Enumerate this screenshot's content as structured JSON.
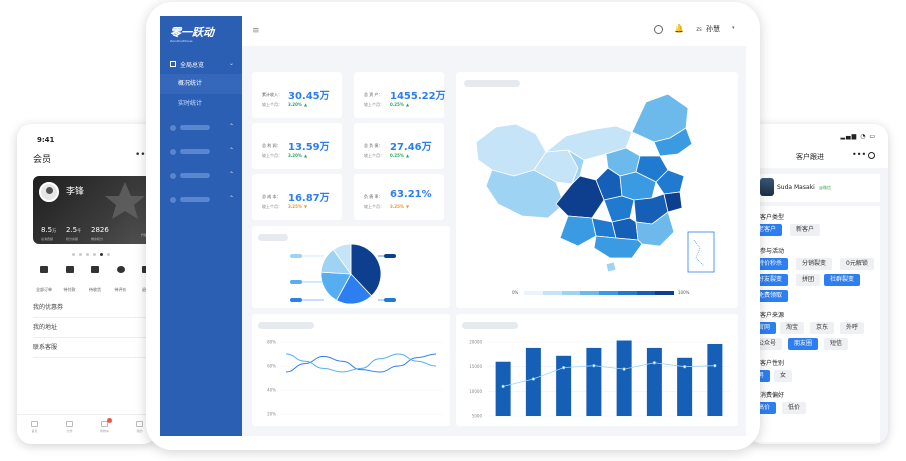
{
  "dashboard": {
    "logo": "零一跃动",
    "logo_sub": "ZeroOneMoves",
    "topbar_user_initial": "ZS",
    "topbar_user": "孙慧",
    "menu": {
      "group": "全局总览",
      "items": [
        {
          "label": "概况统计",
          "active": true
        },
        {
          "label": "实时统计",
          "active": false
        }
      ]
    },
    "kpis": [
      {
        "label": "累计收入：",
        "value": "30.45万",
        "compare_label": "较上个月：",
        "change": "3.20%",
        "trend": "up",
        "color": "#2aa45f"
      },
      {
        "label": "总 资 产：",
        "value": "1455.22万",
        "compare_label": "较上个月：",
        "change": "0.25%",
        "trend": "up",
        "color": "#2aa45f"
      },
      {
        "label": "总 利 润：",
        "value": "13.59万",
        "compare_label": "较上个月：",
        "change": "3.20%",
        "trend": "up",
        "color": "#2aa45f"
      },
      {
        "label": "总 负 债：",
        "value": "27.46万",
        "compare_label": "较上个月：",
        "change": "0.25%",
        "trend": "up",
        "color": "#2aa45f"
      },
      {
        "label": "总 成 本：",
        "value": "16.87万",
        "compare_label": "较上个月：",
        "change": "3.25%",
        "trend": "down",
        "color": "#f0932b"
      },
      {
        "label": "负 债 率：",
        "value": "63.21%",
        "compare_label": "较上个月：",
        "change": "3.25%",
        "trend": "down",
        "color": "#f0932b"
      }
    ],
    "map_legend": {
      "min": "0%",
      "max": "100%",
      "colors": [
        "#eaf4fc",
        "#c6e4f8",
        "#9fd3f3",
        "#6cb9ec",
        "#3a9be2",
        "#1f7ad0",
        "#155fb6",
        "#0d3f8e"
      ]
    },
    "pie": {
      "colors": [
        "#0d3f8e",
        "#2d7ef0",
        "#56aef0",
        "#9fd3f3",
        "#c6e4f8"
      ]
    },
    "bottom_cards": {
      "left": "",
      "right": ""
    }
  },
  "chart_data": [
    {
      "type": "pie",
      "title": "",
      "values": [
        38,
        20,
        18,
        14,
        10
      ]
    },
    {
      "type": "line",
      "title": "",
      "xlabel": "",
      "ylabel": "",
      "y_ticks": [
        "80%",
        "60%",
        "40%",
        "20%"
      ],
      "ylim": [
        20,
        80
      ],
      "x": [
        0,
        1,
        2,
        3,
        4,
        5,
        6,
        7,
        8
      ],
      "series": [
        {
          "values": [
            55,
            62,
            68,
            64,
            57,
            55,
            60,
            67,
            70
          ]
        },
        {
          "values": [
            70,
            64,
            58,
            55,
            58,
            66,
            70,
            64,
            60
          ]
        }
      ]
    },
    {
      "type": "bar",
      "title": "",
      "xlabel": "",
      "ylabel": "",
      "y_ticks": [
        "20000",
        "15000",
        "10000",
        "5000"
      ],
      "ylim": [
        5000,
        20000
      ],
      "categories": [
        "",
        "",
        "",
        "",
        "",
        "",
        "",
        ""
      ],
      "series": [
        {
          "type": "bar",
          "values": [
            16000,
            18800,
            17200,
            18800,
            20300,
            18800,
            16800,
            19600
          ]
        },
        {
          "type": "line",
          "values": [
            11000,
            12500,
            14800,
            15200,
            14500,
            15800,
            15000,
            15200
          ]
        }
      ]
    }
  ],
  "phone_left": {
    "time": "9:41",
    "title": "会员",
    "user_name": "李锋",
    "stats": [
      {
        "value": "8.5",
        "unit": "万",
        "label": "总消费额"
      },
      {
        "value": "2.5",
        "unit": "千",
        "label": "积分余额"
      },
      {
        "value": "2826",
        "unit": "",
        "label": "剩余积分"
      }
    ],
    "extra": "升级攻略",
    "icons": [
      {
        "label": "全部订单"
      },
      {
        "label": "待付款"
      },
      {
        "label": "待收货"
      },
      {
        "label": "待评价"
      },
      {
        "label": "退款"
      }
    ],
    "links": [
      "我的优惠券",
      "我的地址",
      "联系客服"
    ],
    "tabs": [
      "首页",
      "分类",
      "购物车",
      "我的"
    ],
    "badge": "1"
  },
  "phone_right": {
    "title": "客户跟进",
    "user_name": "Suda Masaki",
    "wechat": "@微信",
    "sections": [
      {
        "title": "客户类型",
        "tags": [
          {
            "label": "老客户",
            "active": true
          },
          {
            "label": "新客户",
            "active": false
          }
        ]
      },
      {
        "title": "参与活动",
        "tags": [
          {
            "label": "特价秒杀",
            "active": true
          },
          {
            "label": "分销裂变",
            "active": false
          },
          {
            "label": "0元解锁",
            "active": false
          },
          {
            "label": "好友裂变",
            "active": true
          },
          {
            "label": "拼团",
            "active": false
          },
          {
            "label": "社群裂变",
            "active": true
          },
          {
            "label": "免费领取",
            "active": true
          }
        ]
      },
      {
        "title": "客户来源",
        "tags": [
          {
            "label": "官网",
            "active": true
          },
          {
            "label": "淘宝",
            "active": false
          },
          {
            "label": "京东",
            "active": false
          },
          {
            "label": "外呼",
            "active": false
          },
          {
            "label": "公众号",
            "active": false
          },
          {
            "label": "朋友圈",
            "active": true
          },
          {
            "label": "短信",
            "active": false
          }
        ]
      },
      {
        "title": "客户性别",
        "tags": [
          {
            "label": "男",
            "active": true
          },
          {
            "label": "女",
            "active": false
          }
        ]
      },
      {
        "title": "消费偏好",
        "tags": [
          {
            "label": "高价",
            "active": true
          },
          {
            "label": "低价",
            "active": false
          }
        ]
      }
    ]
  }
}
